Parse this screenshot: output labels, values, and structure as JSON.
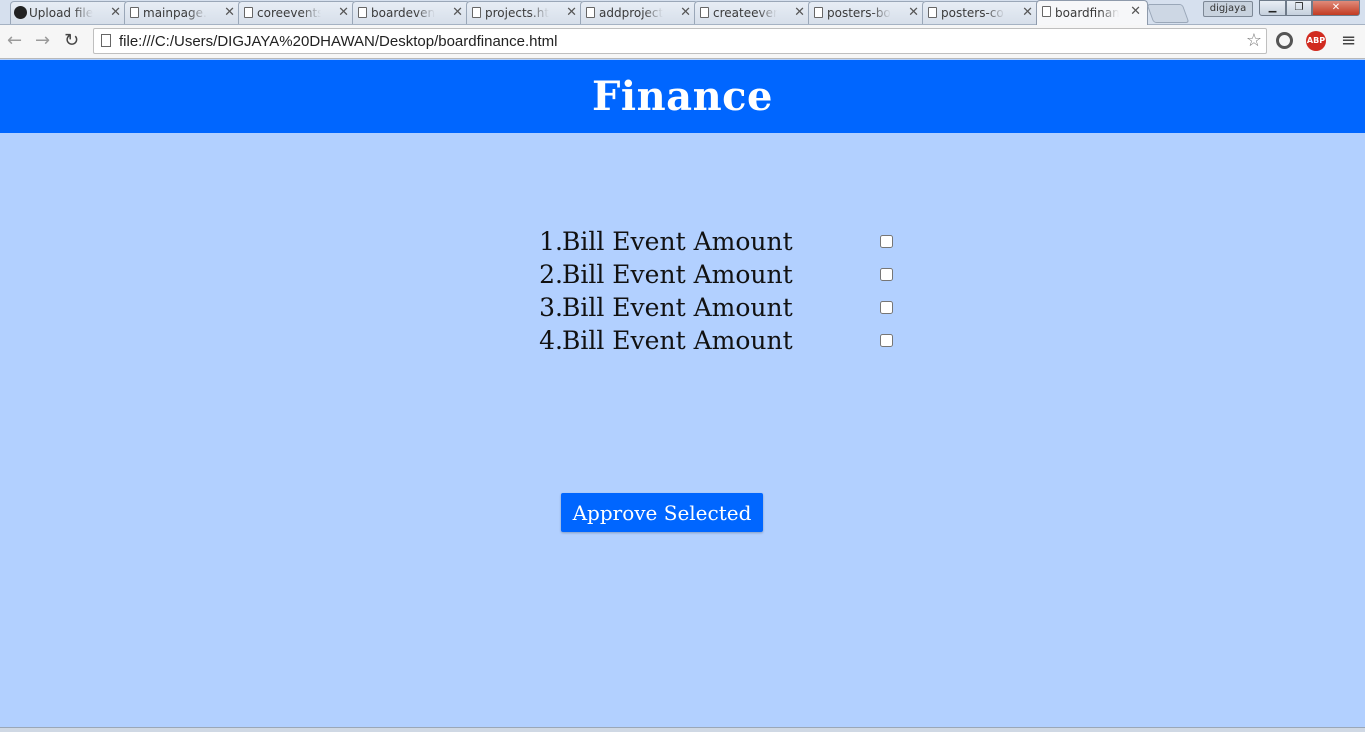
{
  "browser": {
    "tabs": [
      {
        "label": "Upload file",
        "icon": "github-icon"
      },
      {
        "label": "mainpage.h",
        "icon": "page-icon"
      },
      {
        "label": "coreevents",
        "icon": "page-icon"
      },
      {
        "label": "boardevent",
        "icon": "page-icon"
      },
      {
        "label": "projects.ht",
        "icon": "page-icon"
      },
      {
        "label": "addproject",
        "icon": "page-icon"
      },
      {
        "label": "createeven",
        "icon": "page-icon"
      },
      {
        "label": "posters-bo",
        "icon": "page-icon"
      },
      {
        "label": "posters-co",
        "icon": "page-icon"
      },
      {
        "label": "boardfinan",
        "icon": "page-icon",
        "active": true
      }
    ],
    "profile_name": "digjaya",
    "address": "file:///C:/Users/DIGJAYA%20DHAWAN/Desktop/boardfinance.html",
    "close_glyph": "✕",
    "extension_abp": "ABP"
  },
  "page": {
    "title": "Finance",
    "header_color": "#0066ff",
    "background_color": "#b2d0ff",
    "bills": [
      {
        "number": "1.",
        "label": "Bill Event Amount",
        "checked": false
      },
      {
        "number": "2.",
        "label": "Bill Event Amount",
        "checked": false
      },
      {
        "number": "3.",
        "label": "Bill Event Amount",
        "checked": false
      },
      {
        "number": "4.",
        "label": "Bill Event Amount",
        "checked": false
      }
    ],
    "approve_label": "Approve Selected"
  }
}
